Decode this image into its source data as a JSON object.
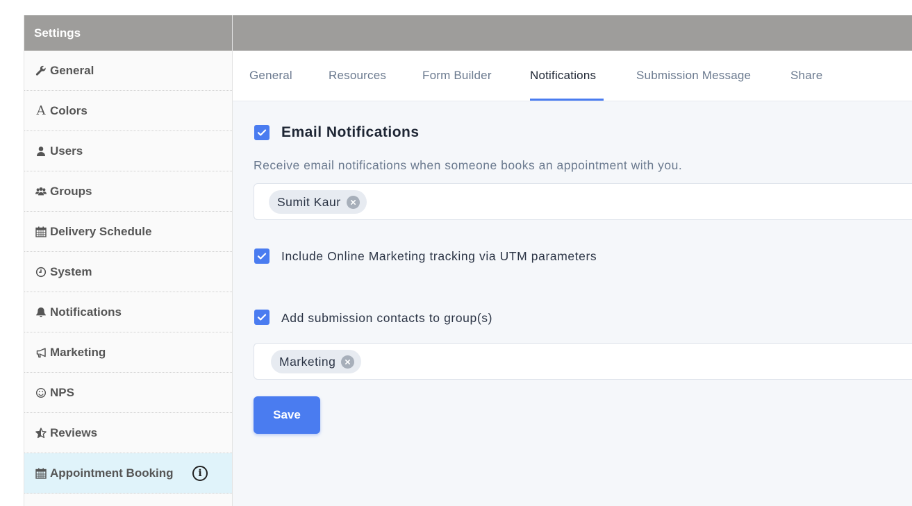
{
  "sidebar": {
    "title": "Settings",
    "items": [
      {
        "label": "General",
        "icon": "wrench-icon"
      },
      {
        "label": "Colors",
        "icon": "font-icon"
      },
      {
        "label": "Users",
        "icon": "user-icon"
      },
      {
        "label": "Groups",
        "icon": "users-icon"
      },
      {
        "label": "Delivery Schedule",
        "icon": "calendar-icon"
      },
      {
        "label": "System",
        "icon": "clock-icon"
      },
      {
        "label": "Notifications",
        "icon": "bell-icon"
      },
      {
        "label": "Marketing",
        "icon": "bullhorn-icon"
      },
      {
        "label": "NPS",
        "icon": "smile-icon"
      },
      {
        "label": "Reviews",
        "icon": "star-icon"
      },
      {
        "label": "Appointment Booking",
        "icon": "calendar-icon",
        "active": true
      }
    ],
    "info_glyph": "i"
  },
  "tabs": [
    {
      "label": "General"
    },
    {
      "label": "Resources"
    },
    {
      "label": "Form Builder"
    },
    {
      "label": "Notifications",
      "active": true
    },
    {
      "label": "Submission Message"
    },
    {
      "label": "Share"
    }
  ],
  "email_notifications": {
    "checked": true,
    "title": "Email Notifications",
    "description": "Receive email notifications when someone books an appointment with you.",
    "recipients": [
      "Sumit Kaur"
    ]
  },
  "utm_tracking": {
    "checked": true,
    "label": "Include Online Marketing tracking via UTM parameters"
  },
  "add_to_groups": {
    "checked": true,
    "label": "Add submission contacts to group(s)",
    "groups": [
      "Marketing"
    ]
  },
  "save_label": "Save",
  "colors": {
    "accent": "#4a7cf0",
    "header": "#9e9d9b",
    "active_sidebar": "#e0f3fa",
    "content_bg": "#f5f7fa"
  }
}
